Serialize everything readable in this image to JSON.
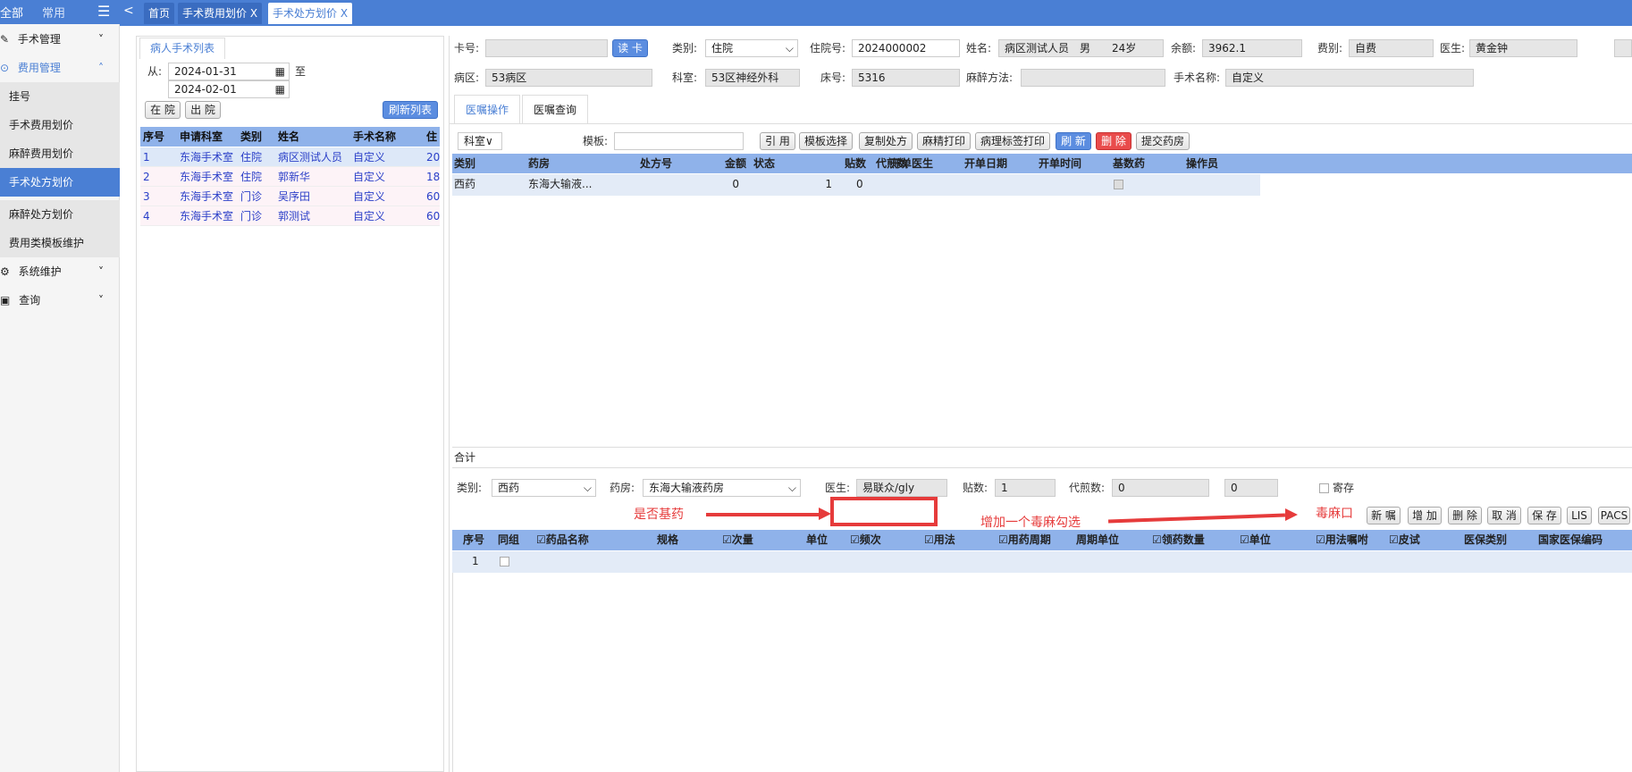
{
  "sidebar": {
    "tabs": [
      "全部",
      "常用"
    ],
    "menu_icon": "menu-icon",
    "items": [
      {
        "label": "手术管理",
        "type": "group",
        "icon": "edit-icon",
        "chevron": "˅"
      },
      {
        "label": "费用管理",
        "type": "group-open",
        "icon": "cost-icon",
        "chevron": "˄"
      },
      {
        "label": "挂号",
        "type": "sub"
      },
      {
        "label": "手术费用划价",
        "type": "sub"
      },
      {
        "label": "麻醉费用划价",
        "type": "sub"
      },
      {
        "label": "手术处方划价",
        "type": "sub-active"
      },
      {
        "label": "麻醉处方划价",
        "type": "sub"
      },
      {
        "label": "费用类模板维护",
        "type": "sub"
      },
      {
        "label": "系统维护",
        "type": "group",
        "icon": "settings-icon",
        "chevron": "˅"
      },
      {
        "label": "查询",
        "type": "group",
        "icon": "query-icon",
        "chevron": "˅"
      }
    ]
  },
  "topbar": {
    "back": "<",
    "tabs": [
      {
        "label": "首页"
      },
      {
        "label": "手术费用划价",
        "close": "X"
      },
      {
        "label": "手术处方划价",
        "close": "X"
      }
    ]
  },
  "left_panel": {
    "tab": "病人手术列表",
    "from_label": "从:",
    "date_from": "2024-01-31",
    "to_label": "至",
    "date_to": "2024-02-01",
    "btn_in": "在 院",
    "btn_out": "出 院",
    "btn_refresh": "刷新列表",
    "columns": [
      "序号",
      "申请科室",
      "类别",
      "姓名",
      "手术名称",
      "住"
    ],
    "rows": [
      [
        "1",
        "东海手术室",
        "住院",
        "病区测试人员",
        "自定义",
        "20"
      ],
      [
        "2",
        "东海手术室",
        "住院",
        "郭新华",
        "自定义",
        "18"
      ],
      [
        "3",
        "东海手术室",
        "门诊",
        "吴序田",
        "自定义",
        "60"
      ],
      [
        "4",
        "东海手术室",
        "门诊",
        "郭测试",
        "自定义",
        "60"
      ]
    ]
  },
  "patient": {
    "card_label": "卡号:",
    "card_value": "",
    "read_card": "读 卡",
    "type_label": "类别:",
    "type_value": "住院",
    "inpatient_label": "住院号:",
    "inpatient_value": "2024000002",
    "name_label": "姓名:",
    "name_value": "病区测试人员　男　　24岁",
    "balance_label": "余额:",
    "balance_value": "3962.1",
    "fee_label": "费别:",
    "fee_value": "自费",
    "doctor_label": "医生:",
    "doctor_value": "黄金钟",
    "ward_label": "病区:",
    "ward_value": "53病区",
    "dept_label": "科室:",
    "dept_value": "53区神经外科",
    "bed_label": "床号:",
    "bed_value": "5316",
    "anes_label": "麻醉方法:",
    "anes_value": "",
    "surgery_label": "手术名称:",
    "surgery_value": "自定义"
  },
  "order_tabs": [
    "医嘱操作",
    "医嘱查询"
  ],
  "toolbar": {
    "dept_select": "科室",
    "template_label": "模板:",
    "template_value": "",
    "buttons": [
      "引 用",
      "模板选择",
      "复制处方",
      "麻精打印",
      "病理标签打印"
    ],
    "refresh": "刷 新",
    "delete": "删 除",
    "submit": "提交药房"
  },
  "rx_table": {
    "columns": [
      "类别",
      "药房",
      "处方号",
      "金额",
      "状态",
      "贴数",
      "代煎数",
      "开单医生",
      "开单日期",
      "开单时间",
      "基数药",
      "操作员"
    ],
    "rows": [
      [
        "西药",
        "东海大输液...",
        "",
        "0",
        "",
        "1",
        "0",
        "",
        "",
        "",
        "",
        ""
      ]
    ],
    "total_label": "合计"
  },
  "detail_form": {
    "type_label": "类别:",
    "type_value": "西药",
    "pharmacy_label": "药房:",
    "pharmacy_value": "东海大输液药房",
    "doctor_label": "医生:",
    "doctor_value": "易联众/gly",
    "doses_label": "贴数:",
    "doses_value": "1",
    "decoct_label": "代煎数:",
    "decoct_value": "0",
    "decoct_value2": "0",
    "hold_label": "寄存"
  },
  "annotations": {
    "left": "是否基药",
    "middle": "增加一个毒麻勾选",
    "right": "毒麻口"
  },
  "detail_buttons": [
    "新 嘱",
    "增 加",
    "删 除",
    "取 消",
    "保 存",
    "LIS",
    "PACS"
  ],
  "detail_table": {
    "columns": [
      "序号",
      "同组",
      "药品名称",
      "规格",
      "次量",
      "单位",
      "频次",
      "用法",
      "用药周期",
      "周期单位",
      "领药数量",
      "单位",
      "用法嘱咐",
      "皮试",
      "医保类别",
      "国家医保编码"
    ],
    "rows": [
      [
        "1",
        "",
        "",
        "",
        "",
        "",
        "",
        "",
        "",
        "",
        "",
        "",
        "",
        "",
        "",
        ""
      ]
    ]
  },
  "colors": {
    "accent": "#4a7fd4",
    "header": "#8fb2ea",
    "annotation": "#e63b3b"
  }
}
